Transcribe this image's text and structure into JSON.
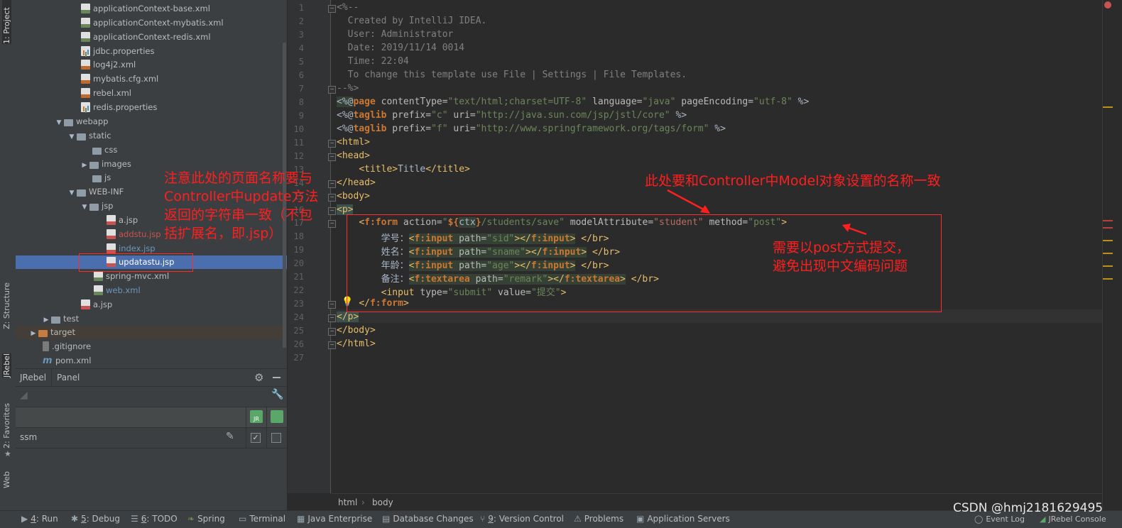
{
  "left_strip": {
    "project_tab": "1: Project",
    "structure_tab": "Z: Structure",
    "jrebel_tab": "JRebel",
    "favorites_tab": "2: Favorites",
    "web_tab": "Web"
  },
  "tree": {
    "items": [
      {
        "label": "applicationContext-base.xml"
      },
      {
        "label": "applicationContext-mybatis.xml"
      },
      {
        "label": "applicationContext-redis.xml"
      },
      {
        "label": "jdbc.properties"
      },
      {
        "label": "log4j2.xml"
      },
      {
        "label": "mybatis.cfg.xml"
      },
      {
        "label": "rebel.xml"
      },
      {
        "label": "redis.properties"
      },
      {
        "label": "webapp"
      },
      {
        "label": "static"
      },
      {
        "label": "css"
      },
      {
        "label": "images"
      },
      {
        "label": "js"
      },
      {
        "label": "WEB-INF"
      },
      {
        "label": "jsp"
      },
      {
        "label": "a.jsp"
      },
      {
        "label": "addstu.jsp"
      },
      {
        "label": "index.jsp"
      },
      {
        "label": "updatastu.jsp"
      },
      {
        "label": "spring-mvc.xml"
      },
      {
        "label": "web.xml"
      },
      {
        "label": "a.jsp"
      },
      {
        "label": "test"
      },
      {
        "label": "target"
      },
      {
        "label": ".gitignore"
      },
      {
        "label": "pom.xml"
      }
    ]
  },
  "annotations": {
    "page_name_note": [
      "注意此处的页面名称要与",
      "Controller中update方法",
      "返回的字符串一致（不包",
      "括扩展名，即.jsp）"
    ],
    "model_note": "此处要和Controller中Model对象设置的名称一致",
    "post_note": [
      "需要以post方式提交，",
      "避免出现中文编码问题"
    ]
  },
  "jrebel": {
    "tab_jrebel": "JRebel",
    "tab_panel": "Panel",
    "module_name": "ssm"
  },
  "editor": {
    "line_numbers": [
      "1",
      "2",
      "3",
      "4",
      "5",
      "6",
      "7",
      "8",
      "9",
      "10",
      "11",
      "12",
      "13",
      "14",
      "15",
      "16",
      "17",
      "18",
      "19",
      "20",
      "21",
      "22",
      "23",
      "24",
      "25",
      "26",
      "27"
    ],
    "comment_open": "<%--",
    "comment_created": "  Created by IntelliJ IDEA.",
    "comment_user": "  User: Administrator",
    "comment_date": "  Date: 2019/11/14 0014",
    "comment_time": "  Time: 22:04",
    "comment_change": "  To change this template use File | Settings | File Templates.",
    "comment_close": "--%>",
    "line8": {
      "open": "<%@",
      "kw": "page",
      "a1": " contentType=",
      "v1": "\"text/html;charset=UTF-8\"",
      "a2": " language=",
      "v2": "\"java\"",
      "a3": " pageEncoding=",
      "v3": "\"utf-8\"",
      "close": " %>"
    },
    "line9": {
      "open": "<%@",
      "kw": "taglib",
      "a1": " prefix=",
      "v1": "\"c\"",
      "a2": " uri=",
      "v2": "\"http://java.sun.com/jsp/jstl/core\"",
      "close": " %>"
    },
    "line10": {
      "open": "<%@",
      "kw": "taglib",
      "a1": " prefix=",
      "v1": "\"f\"",
      "a2": " uri=",
      "v2": "\"http://www.springframework.org/tags/form\"",
      "close": " %>"
    },
    "line11": "<html>",
    "line12": "<head>",
    "line13": {
      "indent": "    ",
      "open": "<title>",
      "text": "Title",
      "close": "</title>"
    },
    "line14": "</head>",
    "line15": "<body>",
    "line16": "<p>",
    "line17": {
      "indent": "    ",
      "lt": "<",
      "tag": "f:form",
      "a1": " action=",
      "q1": "\"",
      "el": "${",
      "ctx": "ctx",
      "el_close": "}",
      "v1": "/students/save\"",
      "a2": " modelAttribute=",
      "v2": "\"student\"",
      "a3": " method=",
      "v3": "\"post\"",
      "gt": ">"
    },
    "line18": {
      "indent": "        ",
      "label": "学号：",
      "lt": "<",
      "tag": "f:input",
      "a1": " path=",
      "v1": "\"sid\"",
      "gt": ">",
      "close_lt": "</",
      "close_tag": "f:input",
      "close_gt": ">",
      "br": " </br>"
    },
    "line19": {
      "indent": "        ",
      "label": "姓名：",
      "lt": "<",
      "tag": "f:input",
      "a1": " path=",
      "v1": "\"sname\"",
      "gt": ">",
      "close_lt": "</",
      "close_tag": "f:input",
      "close_gt": ">",
      "br": " </br>"
    },
    "line20": {
      "indent": "        ",
      "label": "年龄：",
      "lt": "<",
      "tag": "f:input",
      "a1": " path=",
      "v1": "\"age\"",
      "gt": ">",
      "close_lt": "</",
      "close_tag": "f:input",
      "close_gt": ">",
      "br": " </br>"
    },
    "line21": {
      "indent": "        ",
      "label": "备注：",
      "lt": "<",
      "tag": "f:textarea",
      "a1": " path=",
      "v1": "\"remark\"",
      "gt": ">",
      "close_lt": "</",
      "close_tag": "f:textarea",
      "close_gt": ">",
      "br": " </br>"
    },
    "line22": {
      "indent": "        ",
      "open": "<input",
      "a1": " type=",
      "v1": "\"submit\"",
      "a2": " value=",
      "v2": "\"提交\"",
      "close": ">"
    },
    "line23": {
      "indent": "    ",
      "lt": "</",
      "tag": "f:form",
      "gt": ">"
    },
    "line24": "</p>",
    "line25": "</body>",
    "line26": "</html>"
  },
  "breadcrumb": {
    "items": [
      "html",
      "body"
    ]
  },
  "status_bar": {
    "run": {
      "num": "4",
      "label": ": Run"
    },
    "debug": {
      "num": "5",
      "label": ": Debug"
    },
    "todo": {
      "num": "6",
      "label": ": TODO"
    },
    "spring": "Spring",
    "terminal": "Terminal",
    "java_enterprise": "Java Enterprise",
    "database_changes": "Database Changes",
    "version_control": {
      "num": "9",
      "label": ": Version Control"
    },
    "problems": "Problems",
    "application_servers": "Application Servers",
    "event_log": "Event Log",
    "jrebel_console": "JRebel Console"
  },
  "watermark": "CSDN @hmj2181629495",
  "colors": {
    "annotation_red": "#ff1f1f",
    "selection_blue": "#4b6eaf",
    "keyword": "#cc7832",
    "tag": "#e8bf6a",
    "string": "#6a8759"
  },
  "icons": [
    "gear-icon",
    "minimize-icon",
    "wrench-icon",
    "pencil-icon",
    "checkbox-icon",
    "jrebel-icon",
    "bulb-icon",
    "bug-icon",
    "play-icon"
  ]
}
